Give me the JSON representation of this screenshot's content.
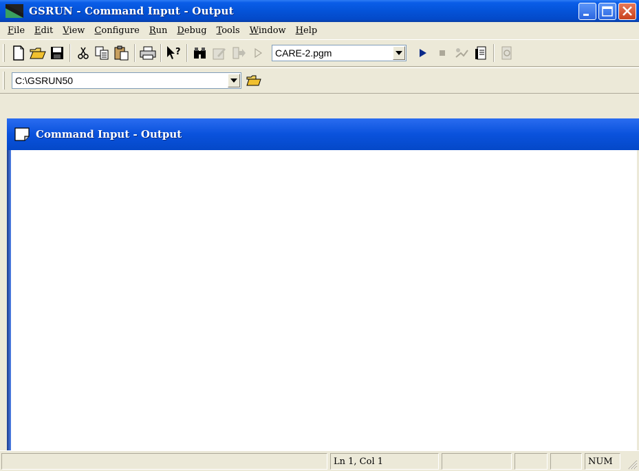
{
  "window": {
    "title": "GSRUN - Command Input - Output"
  },
  "menu": [
    {
      "label": "File",
      "key": "F",
      "rest": "ile"
    },
    {
      "label": "Edit",
      "key": "E",
      "rest": "dit"
    },
    {
      "label": "View",
      "key": "V",
      "rest": "iew"
    },
    {
      "label": "Configure",
      "key": "C",
      "rest": "onfigure"
    },
    {
      "label": "Run",
      "key": "R",
      "rest": "un"
    },
    {
      "label": "Debug",
      "key": "D",
      "rest": "ebug"
    },
    {
      "label": "Tools",
      "key": "T",
      "rest": "ools"
    },
    {
      "label": "Window",
      "key": "W",
      "rest": "indow"
    },
    {
      "label": "Help",
      "key": "H",
      "rest": "elp"
    }
  ],
  "toolbar": {
    "program_select": "CARE-2.pgm"
  },
  "pathbar": {
    "directory": "C:\\GSRUN50"
  },
  "child_window": {
    "title": "Command Input - Output"
  },
  "statusbar": {
    "position": "Ln 1, Col 1",
    "num_lock": "NUM"
  },
  "colors": {
    "titlebar": "#0453d8",
    "face": "#ece9d8"
  }
}
